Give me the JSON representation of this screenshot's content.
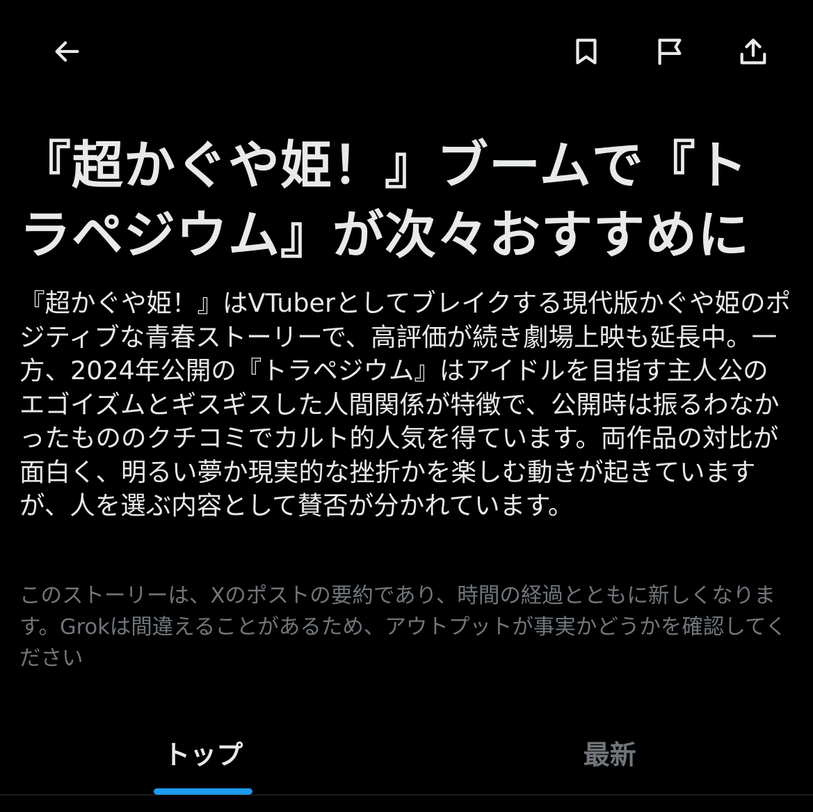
{
  "header": {
    "back_icon": "arrow-left-icon",
    "bookmark_icon": "bookmark-icon",
    "flag_icon": "flag-icon",
    "share_icon": "share-icon"
  },
  "story": {
    "headline": "『超かぐや姫！』ブームで『トラペジウム』が次々おすすめに",
    "summary": "『超かぐや姫！』はVTuberとしてブレイクする現代版かぐや姫のポジティブな青春ストーリーで、高評価が続き劇場上映も延長中。一方、2024年公開の『トラペジウム』はアイドルを目指す主人公のエゴイズムとギスギスした人間関係が特徴で、公開時は振るわなかったもののクチコミでカルト的人気を得ています。両作品の対比が面白く、明るい夢か現実的な挫折かを楽しむ動きが起きていますが、人を選ぶ内容として賛否が分かれています。",
    "disclaimer": "このストーリーは、Xのポストの要約であり、時間の経過とともに新しくなります。Grokは間違えることがあるため、アウトプットが事実かどうかを確認してください"
  },
  "tabs": [
    {
      "label": "トップ",
      "active": true
    },
    {
      "label": "最新",
      "active": false
    }
  ],
  "colors": {
    "background": "#000000",
    "text_primary": "#e7e9ea",
    "text_secondary": "#71767b",
    "accent": "#1d9bf0"
  }
}
